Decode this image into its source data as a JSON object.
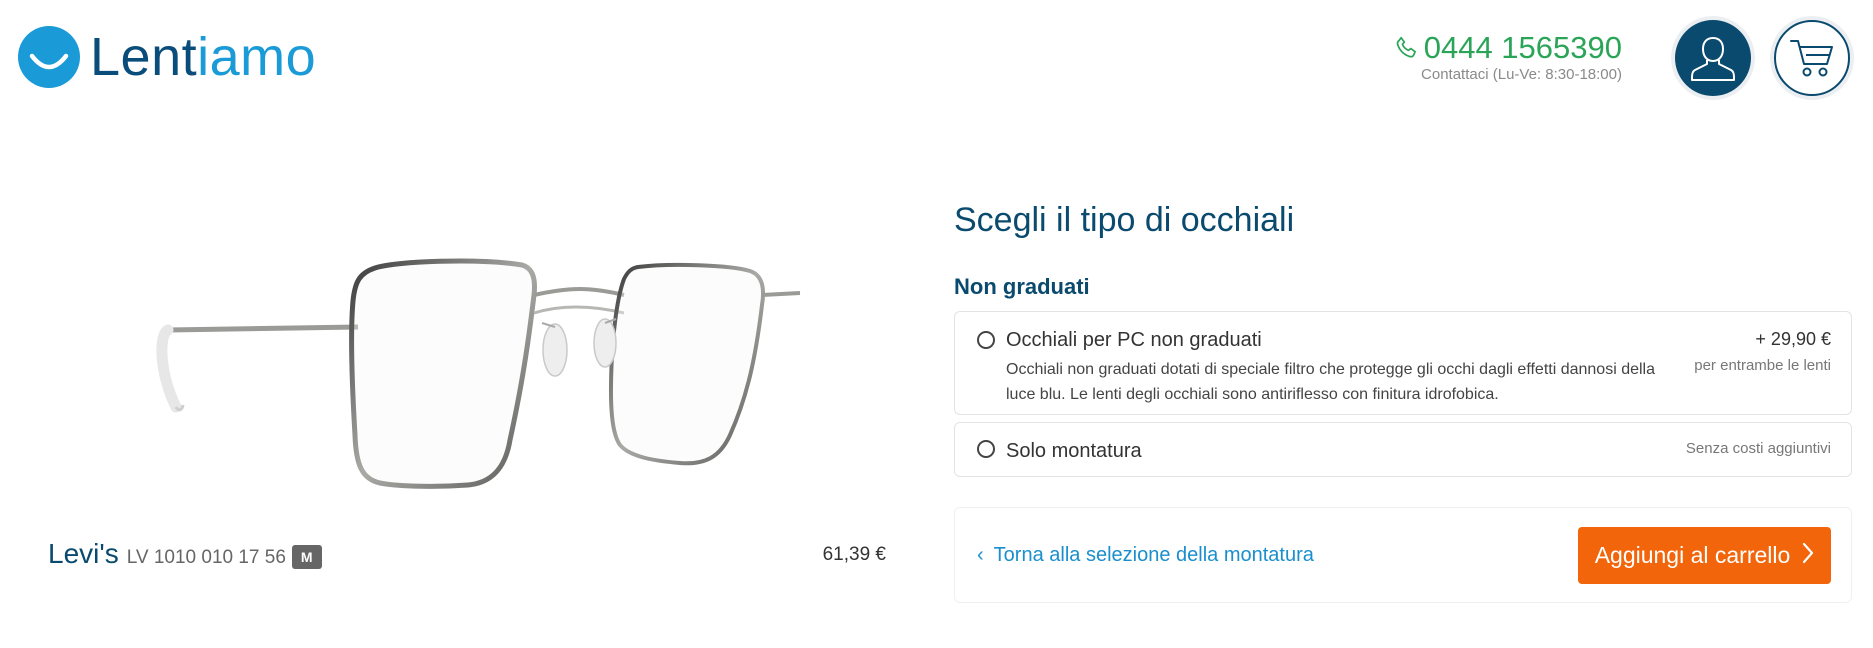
{
  "header": {
    "logo": {
      "part1": "Lent",
      "part2": "iamo"
    },
    "phone": {
      "number": "0444 1565390",
      "hours": "Contattaci (Lu-Ve: 8:30-18:00)",
      "icon": "phone-icon"
    },
    "account_icon": "user-icon",
    "cart_icon": "shopping-cart-icon"
  },
  "product": {
    "brand": "Levi's",
    "model": "LV 1010 010 17 56",
    "size": "M",
    "price": "61,39 €"
  },
  "selection": {
    "title": "Scegli il tipo di occhiali",
    "group_title": "Non graduati",
    "options": [
      {
        "title": "Occhiali per PC non graduati",
        "description": "Occhiali non graduati dotati di speciale filtro che protegge gli occhi dagli effetti dannosi della luce blu. Le lenti degli occhiali sono antiriflesso con finitura idrofobica.",
        "price": "+ 29,90 €",
        "price_note": "per entrambe le lenti"
      },
      {
        "title": "Solo montatura",
        "price_note": "Senza costi aggiuntivi"
      }
    ]
  },
  "footer": {
    "back_label": "Torna alla selezione della montatura",
    "add_to_cart_label": "Aggiungi al carrello"
  },
  "colors": {
    "brand_dark": "#0a4a6e",
    "brand_light": "#1a9ad6",
    "phone_green": "#2aa558",
    "cta_orange": "#f2650a",
    "link_blue": "#1a8fce"
  }
}
